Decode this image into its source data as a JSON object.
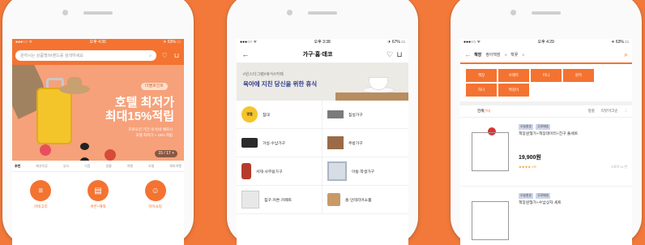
{
  "colors": {
    "background": "#f2793a",
    "accent": "#f47331",
    "navy": "#2f3a8a"
  },
  "phone1": {
    "status": {
      "left": "●●●○○ ᯤ",
      "time": "오후 4:35",
      "right": "✈ 63% ▭"
    },
    "search": {
      "placeholder": "원하시는 상품명/브랜드를 검색하세요"
    },
    "icons": {
      "search": "search-icon",
      "heart": "heart-icon",
      "cart": "cart-icon"
    },
    "banner": {
      "badge": "더블포인트",
      "title_line1": "호텔 최저가",
      "title_line2": "최대15%적립",
      "sub_line1": "프로모션 기간 내 숙박 예약시",
      "sub_line2": "호텔 최저가 + 15% 적립",
      "page": "15 / 17  +"
    },
    "tabs": [
      "추천",
      "패션의류",
      "뷰티",
      "식품",
      "생활",
      "여행",
      "호텔",
      "해외여행"
    ],
    "quick": [
      {
        "icon": "list-icon",
        "label": "카테고리"
      },
      {
        "icon": "coupon-icon",
        "label": "쿠폰+혜택"
      },
      {
        "icon": "person-icon",
        "label": "마이쇼핑"
      }
    ]
  },
  "phone2": {
    "status": {
      "left": "●●●○○ ᯤ",
      "time": "오후 3:38",
      "right": "✈ 67% ▭"
    },
    "title": "가구·홈·데코",
    "banner": {
      "small": "#원스타그램#휴식#카페",
      "main": "육아에 지친 당신을 위한 휴식"
    },
    "categories": [
      {
        "label": "침대",
        "thumb": "bed-thumb",
        "badge": "명절"
      },
      {
        "label": "침실가구",
        "thumb": "bedroom-thumb",
        "badge": ""
      },
      {
        "label": "거실·수납가구",
        "thumb": "sofa-thumb",
        "badge": ""
      },
      {
        "label": "주방가구",
        "thumb": "dining-thumb",
        "badge": ""
      },
      {
        "label": "서재·사무용가구",
        "thumb": "chair-thumb",
        "badge": ""
      },
      {
        "label": "아동·학생가구",
        "thumb": "kids-thumb",
        "badge": ""
      },
      {
        "label": "침구·커튼·카페트",
        "thumb": "curtain-thumb",
        "badge": ""
      },
      {
        "label": "홈·인테리어소품",
        "thumb": "stool-thumb",
        "badge": ""
      }
    ]
  },
  "phone3": {
    "status": {
      "left": "●●●○○ ᯤ",
      "time": "오후 4:29",
      "right": "✈ 63% ▭"
    },
    "query": {
      "keyword": "책장",
      "related1": "쌍아책장",
      "related2": "책꽂"
    },
    "tags": [
      "책장",
      "쓰레트",
      "미니",
      "원목",
      "하나",
      "벽걸이"
    ],
    "filter": {
      "all": "전체",
      "count": "(70)",
      "sort1": "정렬",
      "sort2": "리뷰마크순"
    },
    "products": [
      {
        "badges": [
          "오늘발송",
          "무료배송"
        ],
        "name": "책장원형가+책장데이터+친구 풀세트",
        "price": "19,900원",
        "rating": "★★★★ 4회",
        "meta": "스토어 11 번"
      },
      {
        "badges": [
          "오늘발송",
          "무료배송"
        ],
        "name": "책장원형가+수납상자 세트",
        "price": "",
        "rating": "",
        "meta": ""
      }
    ]
  }
}
